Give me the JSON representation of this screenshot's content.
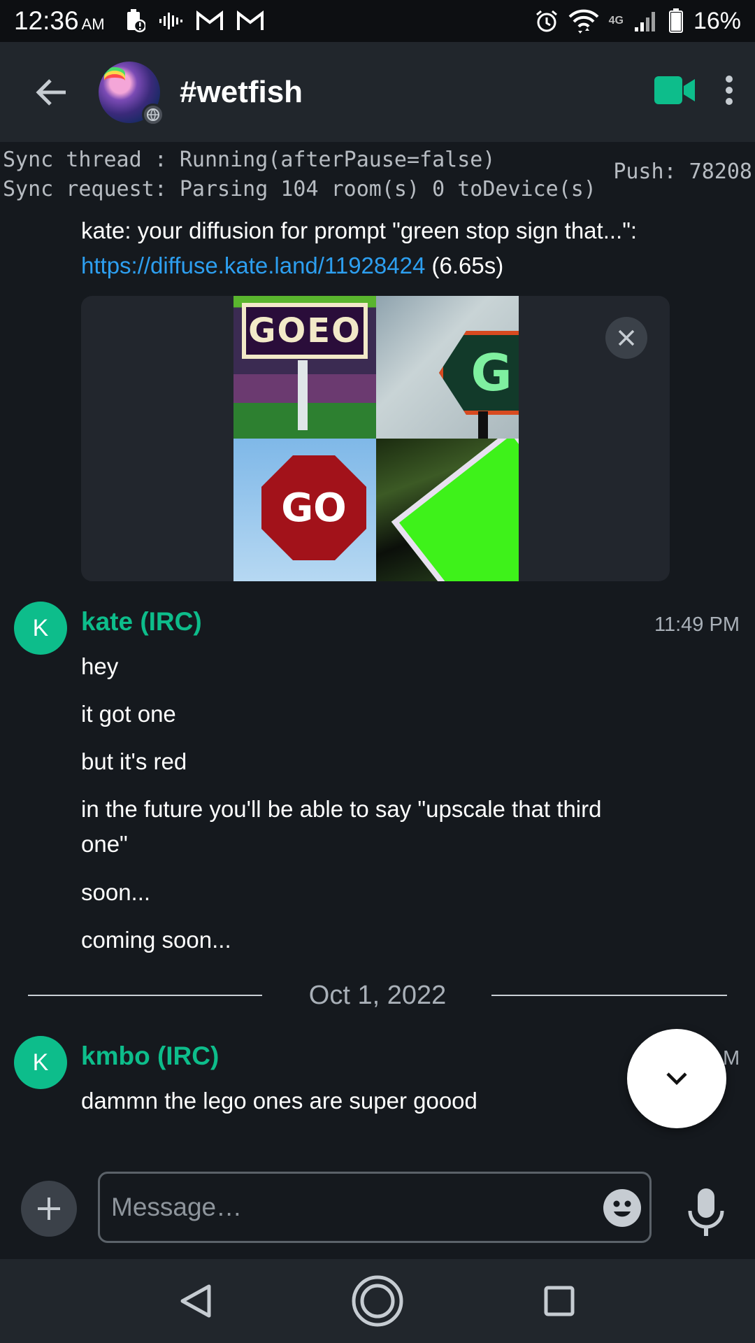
{
  "status_bar": {
    "time": "12:36",
    "ampm": "AM",
    "network": "4G",
    "battery": "16%"
  },
  "toolbar": {
    "title": "#wetfish"
  },
  "debug": {
    "sync_thread": "Sync thread : Running(afterPause=false)",
    "sync_request": "Sync request: Parsing 104 room(s) 0 toDevice(s)",
    "push": "Push: 78208"
  },
  "timeline": {
    "notice": {
      "text": "kate: your diffusion for prompt \"green stop sign that...\": ",
      "link": "https://diffuse.kate.land/11928424",
      "suffix": " (6.65s)"
    },
    "image_tiles": [
      "GOEO",
      "G",
      "GO",
      ""
    ],
    "group1": {
      "avatar_letter": "K",
      "sender": "kate (IRC)",
      "time": "11:49 PM",
      "messages": [
        "hey",
        "it got one",
        "but it's red",
        "in the future you'll be able to say \"upscale that third one\"",
        "soon...",
        "coming soon..."
      ]
    },
    "date_separator": "Oct 1, 2022",
    "group2": {
      "avatar_letter": "K",
      "sender": "kmbo (IRC)",
      "time_fragment": "M",
      "messages": [
        "dammn the lego ones are super goood"
      ]
    }
  },
  "composer": {
    "placeholder": "Message…"
  }
}
